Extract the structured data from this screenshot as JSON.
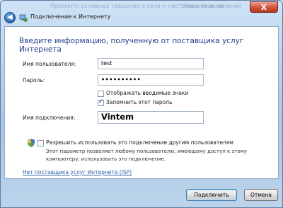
{
  "window": {
    "title": "Подключение к Интернету",
    "bg_text_1": "Просмотр основных сведений о сети и настройка подключений",
    "bg_text_2": "Подключение",
    "close_glyph": "X",
    "back_glyph": "◀"
  },
  "page": {
    "heading": "Введите информацию, полученную от поставщика услуг Интернета"
  },
  "form": {
    "username_label": "Имя пользователя:",
    "username_value": "test",
    "password_label": "Пароль:",
    "password_value": "••••••••••",
    "show_chars_label": "Отображать вводимые знаки",
    "show_chars_checked": false,
    "remember_label": "Запомнить этот пароль",
    "remember_checked": true,
    "conn_name_label": "Имя подключения:",
    "conn_name_value": "Vintem"
  },
  "sharing": {
    "allow_label": "Разрешить использовать это подключение другим пользователям",
    "allow_checked": false,
    "description": "Этот параметр позволяет любому пользователю, имеющему доступ к этому компьютеру, использовать это подключение."
  },
  "link": {
    "no_isp": "Нет поставщика услуг Интернета (ISP)"
  },
  "buttons": {
    "connect": "Подключить",
    "cancel": "Отмена"
  },
  "colors": {
    "heading": "#1e3d8f",
    "link": "#2d63a8",
    "close": "#c8452a"
  }
}
